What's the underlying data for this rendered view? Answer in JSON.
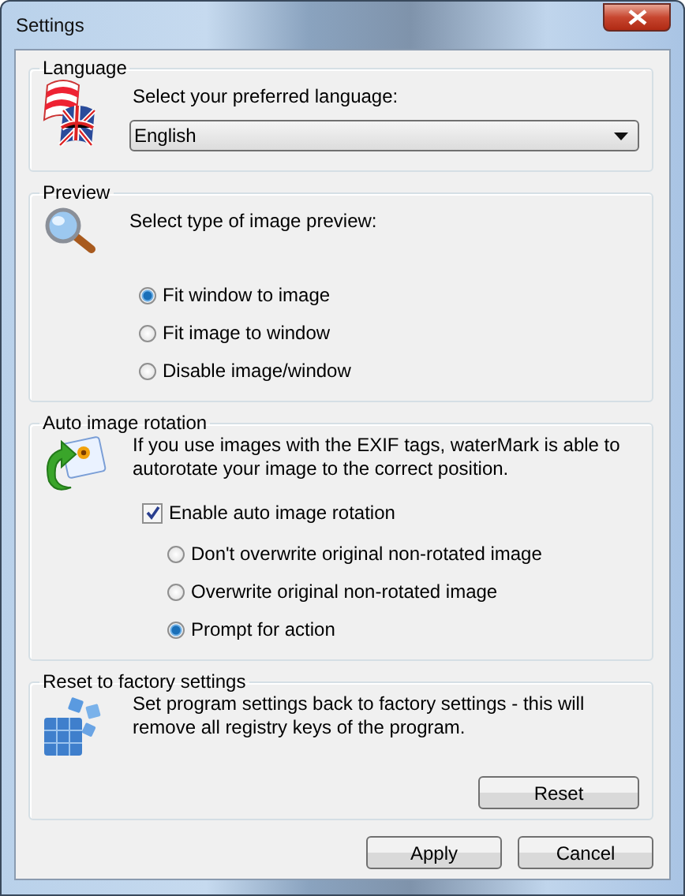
{
  "window": {
    "title": "Settings"
  },
  "language": {
    "title": "Language",
    "prompt": "Select your preferred language:",
    "value": "English"
  },
  "preview": {
    "title": "Preview",
    "prompt": "Select type of image preview:",
    "options": [
      {
        "label": "Fit window to image",
        "selected": true
      },
      {
        "label": "Fit image to window",
        "selected": false
      },
      {
        "label": "Disable image/window",
        "selected": false
      }
    ]
  },
  "rotation": {
    "title": "Auto image rotation",
    "description": "If you use images with the EXIF tags, waterMark is able to autorotate your image to the correct position.",
    "checkbox": {
      "label": "Enable auto image rotation",
      "checked": true
    },
    "options": [
      {
        "label": "Don't overwrite original non-rotated image",
        "selected": false
      },
      {
        "label": "Overwrite original non-rotated image",
        "selected": false
      },
      {
        "label": "Prompt for action",
        "selected": true
      }
    ]
  },
  "reset": {
    "title": "Reset to factory settings",
    "description": "Set program settings back to factory settings - this will remove all registry keys of the program.",
    "button": "Reset"
  },
  "buttons": [
    "Apply",
    "Cancel"
  ]
}
